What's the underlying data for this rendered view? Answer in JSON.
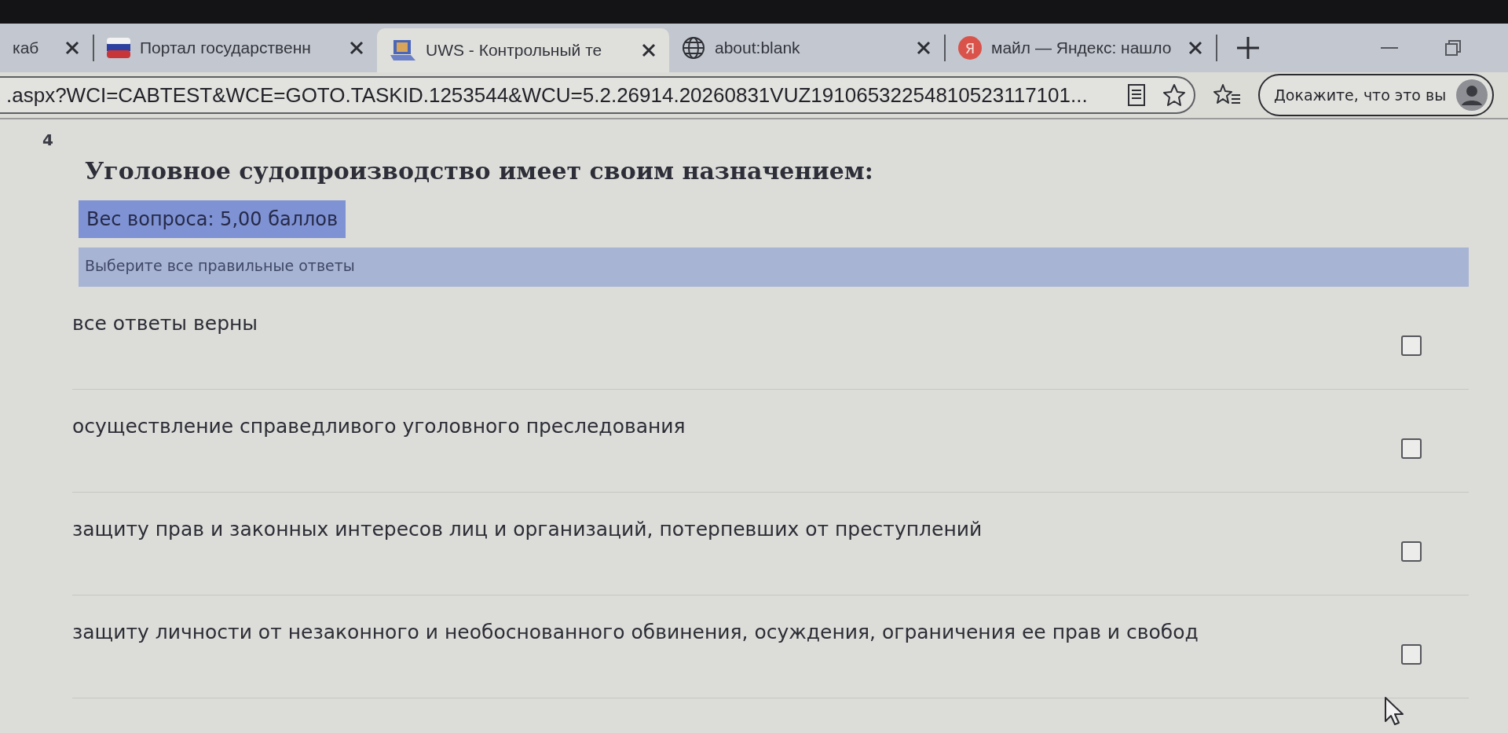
{
  "browser": {
    "tabs": [
      {
        "title": "каб",
        "selected": false,
        "kind": "plain"
      },
      {
        "title": "Портал государственн",
        "selected": false,
        "kind": "flag"
      },
      {
        "title": "UWS - Контрольный те",
        "selected": true,
        "kind": "app"
      },
      {
        "title": "about:blank",
        "selected": false,
        "kind": "globe"
      },
      {
        "title": "майл — Яндекс: нашло",
        "selected": false,
        "kind": "letter",
        "logo_letter": "Я"
      }
    ],
    "address_bar": {
      "url": ".aspx?WCI=CABTEST&WCE=GOTO.TASKID.1253544&WCU=5.2.26914.20260831VUZ19106532254810523117101..."
    },
    "profile_button": {
      "label": "Докажите, что это вы"
    }
  },
  "page": {
    "question_number": "4",
    "question": "Уголовное судопроизводство имеет своим назначением:",
    "weight": "Вес вопроса: 5,00 баллов",
    "instruction": "Выберите все правильные ответы",
    "answers": [
      {
        "text": "все ответы верны",
        "checked": false
      },
      {
        "text": "осуществление справедливого уголовного преследования",
        "checked": false
      },
      {
        "text": "защиту прав и законных интересов лиц и организаций, потерпевших от преступлений",
        "checked": false
      },
      {
        "text": "защиту личности от незаконного и необоснованного обвинения, осуждения, ограничения ее прав и свобод",
        "checked": false
      }
    ]
  }
}
